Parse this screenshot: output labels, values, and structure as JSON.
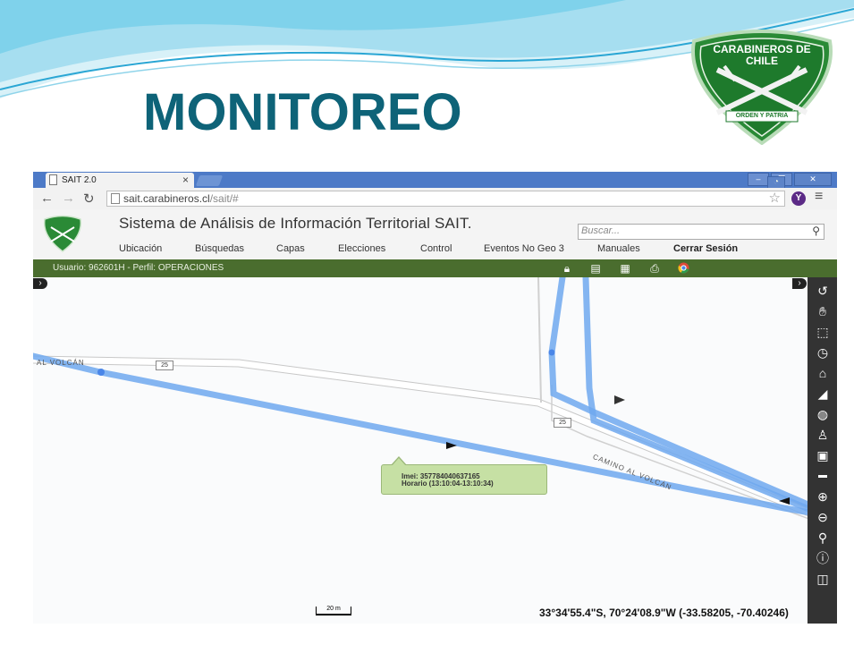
{
  "slide": {
    "title": "MONITOREO",
    "badge_top": "CARABINEROS DE",
    "badge_bottom": "CHILE",
    "badge_motto": "ORDEN Y PATRIA",
    "colors": {
      "title": "#0e6378",
      "badge_green": "#1e7a2c",
      "wave": "#5ec8e8"
    }
  },
  "browser": {
    "tab_title": "SAIT 2.0",
    "tab_close": "×",
    "url_host": "sait.carabineros.cl",
    "url_path": "/sait/#",
    "profile_letter": "Y"
  },
  "app": {
    "title": "Sistema de Análisis de Información Territorial SAIT.",
    "search_placeholder": "Buscar...",
    "menu": [
      "Ubicación",
      "Búsquedas",
      "Capas",
      "Elecciones",
      "Control",
      "Eventos No Geo 3",
      "Manuales"
    ],
    "logout": "Cerrar Sesión",
    "user_info": "Usuario: 962601H - Perfil: OPERACIONES",
    "bar_color": "#4a6d2e"
  },
  "map": {
    "road_label_1": "AL VOLCÁN",
    "road_label_2": "CAMINO AL VOLCÁN",
    "route_badge_1": "25",
    "route_badge_2": "25",
    "popup_imei": "Imei: 357784040637165",
    "popup_time": "Horario (13:10:04-13:10:34)",
    "scale_label": "20 m",
    "coordinates": "33°34'55.4\"S, 70°24'08.9\"W (-33.58205, -70.40246)",
    "track_color": "#6fa8ef"
  },
  "sidebar_tools": [
    "refresh-icon",
    "pan-hand-icon",
    "select-icon",
    "clock-icon",
    "home-search-icon",
    "ruler-icon",
    "globe-icon",
    "street-view-icon",
    "map-frame-icon",
    "scale-bar-icon",
    "zoom-in-icon",
    "zoom-out-icon",
    "search-icon",
    "info-icon",
    "area-icon"
  ]
}
